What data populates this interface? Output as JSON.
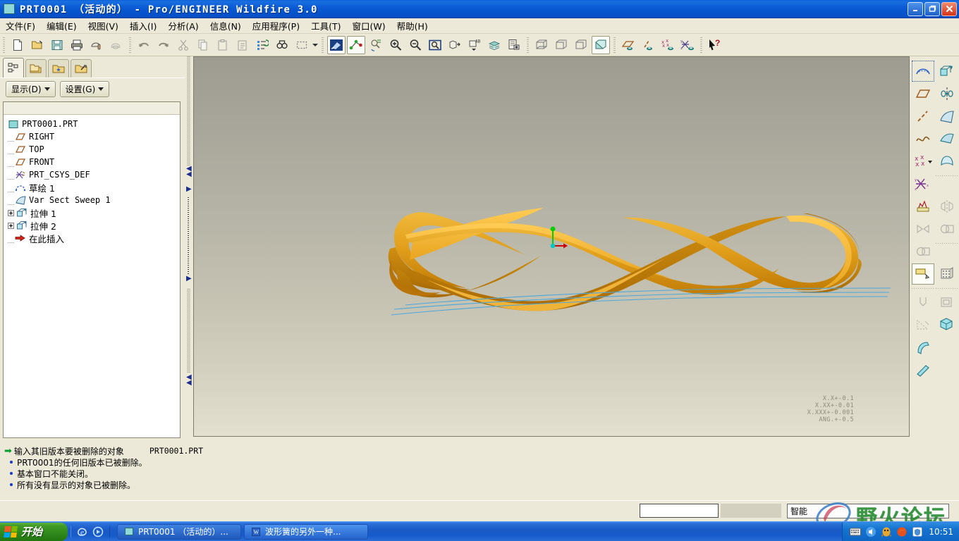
{
  "window": {
    "title": "PRT0001 （活动的） - Pro/ENGINEER Wildfire 3.0",
    "minimize_label": "_",
    "maximize_label": "❐",
    "close_label": "✕"
  },
  "menu": {
    "items": [
      {
        "label": "文件(F)",
        "name": "menu-file"
      },
      {
        "label": "编辑(E)",
        "name": "menu-edit"
      },
      {
        "label": "视图(V)",
        "name": "menu-view"
      },
      {
        "label": "插入(I)",
        "name": "menu-insert"
      },
      {
        "label": "分析(A)",
        "name": "menu-analysis"
      },
      {
        "label": "信息(N)",
        "name": "menu-info"
      },
      {
        "label": "应用程序(P)",
        "name": "menu-applications"
      },
      {
        "label": "工具(T)",
        "name": "menu-tools"
      },
      {
        "label": "窗口(W)",
        "name": "menu-window"
      },
      {
        "label": "帮助(H)",
        "name": "menu-help"
      }
    ]
  },
  "toolbar": {
    "icons": [
      "new-file-icon",
      "open-folder-icon",
      "save-icon",
      "print-icon",
      "mail-icon",
      "mail-disabled-icon",
      "undo-icon",
      "redo-icon",
      "cut-icon",
      "copy-icon",
      "paste-icon",
      "paste-special-icon",
      "regenerate-icon",
      "find-icon",
      "select-box-icon",
      "repaint-icon",
      "datum-display-icon",
      "layer-view-icon",
      "zoom-in-icon",
      "zoom-out-icon",
      "refit-icon",
      "reorient-icon",
      "saved-views-icon",
      "layers-icon",
      "view-manager-icon",
      "wireframe-icon",
      "hidden-line-icon",
      "no-hidden-icon",
      "shaded-icon",
      "datum-plane-icon",
      "datum-axis-icon",
      "datum-point-icon",
      "datum-csys-icon",
      "help-pointer-icon"
    ]
  },
  "model_tree": {
    "tabs": [
      "model-tree-tab",
      "folder-browser-tab",
      "favorites-tab",
      "connections-tab"
    ],
    "show_button": "显示(D)",
    "settings_button": "设置(G)",
    "nodes": [
      {
        "label": "PRT0001.PRT",
        "icon": "part-icon",
        "depth": 0,
        "expander": "none",
        "cjk": false
      },
      {
        "label": "RIGHT",
        "icon": "plane-icon",
        "depth": 1,
        "expander": "none",
        "cjk": false
      },
      {
        "label": "TOP",
        "icon": "plane-icon",
        "depth": 1,
        "expander": "none",
        "cjk": false
      },
      {
        "label": "FRONT",
        "icon": "plane-icon",
        "depth": 1,
        "expander": "none",
        "cjk": false
      },
      {
        "label": "PRT_CSYS_DEF",
        "icon": "csys-icon",
        "depth": 1,
        "expander": "none",
        "cjk": false
      },
      {
        "label": "草绘 1",
        "icon": "sketch-icon",
        "depth": 1,
        "expander": "none",
        "cjk": true
      },
      {
        "label": "Var Sect Sweep 1",
        "icon": "sweep-icon",
        "depth": 1,
        "expander": "none",
        "cjk": false
      },
      {
        "label": "拉伸 1",
        "icon": "extrude-icon",
        "depth": 1,
        "expander": "plus",
        "cjk": true
      },
      {
        "label": "拉伸 2",
        "icon": "extrude-icon",
        "depth": 1,
        "expander": "plus",
        "cjk": true
      },
      {
        "label": "在此插入",
        "icon": "insert-here-icon",
        "depth": 1,
        "expander": "none",
        "cjk": true
      }
    ]
  },
  "viewport": {
    "model_name": "wave-spring-ribbon-model",
    "tolerance_lines": [
      "X.X+-0.1",
      "X.XX+-0.01",
      "X.XXX+-0.001",
      "ANG.+-0.5"
    ]
  },
  "right_toolbar": {
    "icons": [
      "sketch-tool-icon",
      "extrude-tool-icon",
      "datum-plane-tool-icon",
      "revolve-tool-icon",
      "datum-axis-tool-icon",
      "sweep-tool-icon",
      "curve-tool-icon",
      "blend-tool-icon",
      "datum-point-tool-icon",
      "boundary-blend-icon",
      "datum-csys-tool-icon",
      "mirror-tool-icon",
      "datum-graph-icon",
      "pattern-tool-icon",
      "analysis-feature-icon",
      "merge-tool-icon",
      "layer-tool-icon",
      "style-tool-icon",
      "hole-tool-icon",
      "shell-tool-icon",
      "rib-tool-icon",
      "draft-tool-icon",
      "round-tool-icon",
      "chamfer-tool-icon"
    ]
  },
  "messages": {
    "prompt": "输入其旧版本要被删除的对象",
    "prompt_value": "PRT0001.PRT",
    "lines": [
      "PRT0001的任何旧版本已被删除。",
      "基本窗口不能关闭。",
      "所有没有显示的对象已被删除。"
    ]
  },
  "bottom": {
    "input_value": "",
    "ime_label": "智能",
    "watermark": "野火论坛"
  },
  "taskbar": {
    "start_label": "开始",
    "quick_launch": [
      "ie-icon",
      "media-icon"
    ],
    "items": [
      {
        "label": "PRT0001 （活动的）...",
        "icon": "proe-icon",
        "active": true
      },
      {
        "label": "波形簧的另外一种...",
        "icon": "word-icon",
        "active": false
      }
    ],
    "tray_icons": [
      "keyboard-icon",
      "volume-icon",
      "qq-icon",
      "firefox-icon",
      "shield-icon"
    ],
    "clock": "10:51"
  },
  "colors": {
    "titlebar": "#0a5ad4",
    "chrome": "#ece9d8",
    "model_orange": "#e09a18",
    "model_orange_dark": "#c97f0b",
    "axis_green": "#00d400",
    "axis_red": "#d00000",
    "curve_blue": "#4aa8dd"
  }
}
